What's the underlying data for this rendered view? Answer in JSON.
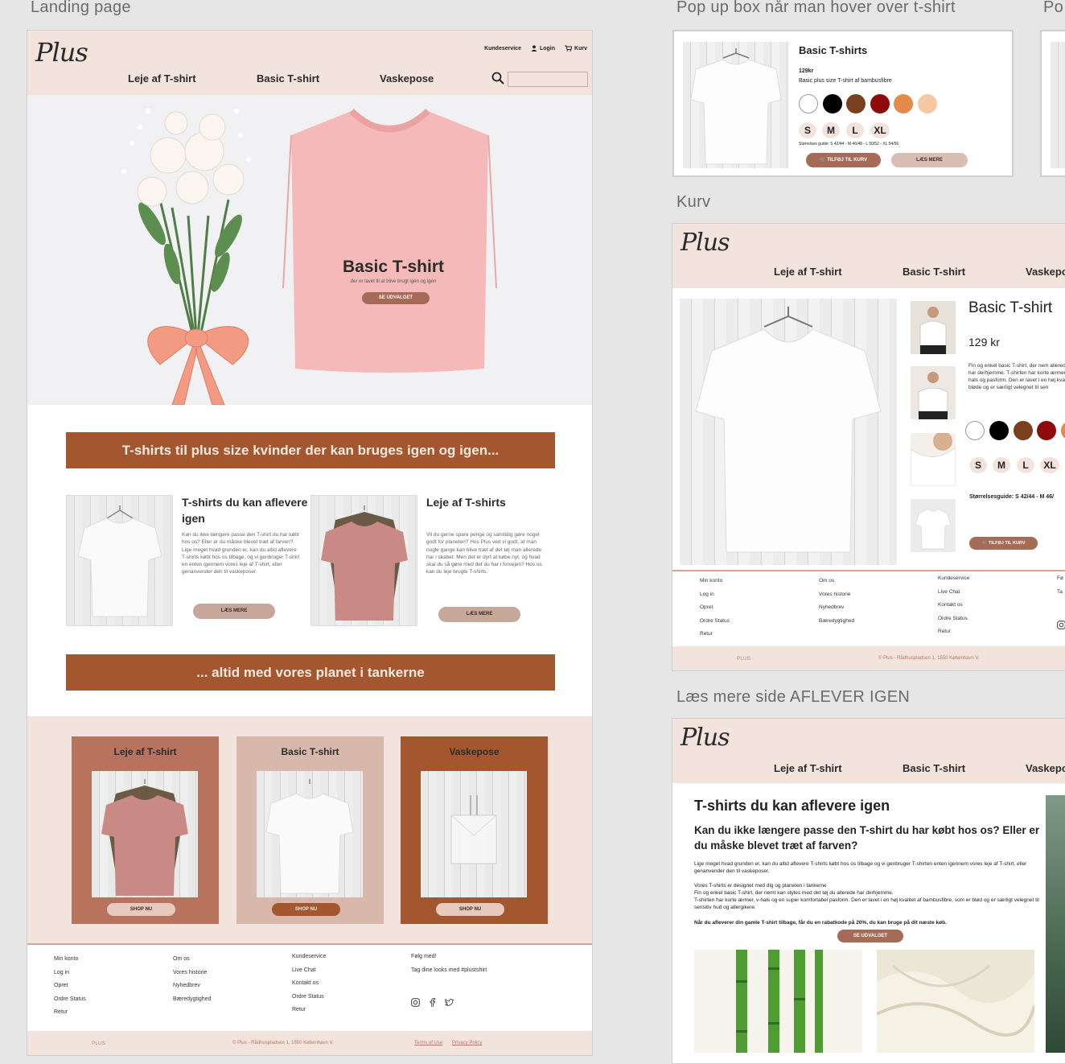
{
  "labels": {
    "landing": "Landing page",
    "popup": "Pop up box når man hover over t-shirt",
    "popup2": "Po",
    "kurv": "Kurv",
    "laes": "Læs mere side AFLEVER IGEN"
  },
  "brand": {
    "logo": "Plus"
  },
  "header": {
    "nav": [
      "Leje af T-shirt",
      "Basic T-shirt",
      "Vaskepose"
    ],
    "nav_cut": "Vaskepo",
    "util": {
      "kundeservice": "Kundeservice",
      "login": "Login",
      "kurv": "Kurv"
    }
  },
  "hero": {
    "title": "Basic T-shirt",
    "subtitle": "der er lavet til at blive brugt igen og igen",
    "button": "SE UDVALGET"
  },
  "banners": {
    "first": "T-shirts til plus size kvinder der kan bruges igen og igen...",
    "second": "... altid med vores planet i tankerne"
  },
  "cards": [
    {
      "title": "T-shirts du kan aflevere igen",
      "text": "Kan du ikke længere passe den T-shirt du har købt hos os? Eller er du måske blevet træt af farven? Lige meget hvad grunden er, kan du altid aflevere T-shirts købt hos os tilbage, og vi genbruger T-shirt en enten igennem vores leje af T-shirt, eller genanvender den til vaskeposer.",
      "button": "LÆS MERE"
    },
    {
      "title": "Leje af T-shirts",
      "text": "Vil du gerne spare penge og samtidig gøre noget godt for planeten? Hos Plus ved vi godt, at man nogle gange kan blive træt af det tøj man allerede har i skabet. Men det er dyrt at købe nyt, og hvad skal du så gøre med det du har i forvejen? Hos os kan du leje brugte T-shirts.",
      "button": "LÆS MERE"
    }
  ],
  "categories": [
    {
      "title": "Leje af T-shirt",
      "button": "SHOP NU"
    },
    {
      "title": "Basic T-shirt",
      "button": "SHOP NU"
    },
    {
      "title": "Vaskepose",
      "button": "SHOP NU"
    }
  ],
  "footer": {
    "col1": [
      "Min konto",
      "Log in",
      "Opret",
      "Ordre Status",
      "Retur"
    ],
    "col2": [
      "Om os",
      "Vores historie",
      "Nyhedbrev",
      "Bæredygtighed"
    ],
    "col3": [
      "Kundeservice",
      "Live Chat",
      "Kontakt os",
      "Ordre Status",
      "Retur"
    ],
    "col4": [
      "Følg med!",
      "Tag dine looks med #plustshirt"
    ],
    "col4_cut": [
      "Fø",
      "Ta"
    ],
    "brand": "PLUS",
    "address": "© Plus - Rådhuspladsen 1, 1550 København V.",
    "terms": "Terms of Use",
    "privacy": "Privacy Policy"
  },
  "popup": {
    "title": "Basic T-shirts",
    "price": "129kr",
    "desc": "Basic plus size T-shirt af bambusfibre",
    "sizes": [
      "S",
      "M",
      "L",
      "XL"
    ],
    "size_guide": "Størrelses guide: S 42/44 - M 46/48 - L 50/52 - XL 54/56",
    "add_button": "TILFØJ TIL KURV",
    "more_button": "LÆS MERE"
  },
  "product": {
    "title": "Basic T-shirt",
    "price": "129 kr",
    "desc": "Fin og enkel basic T-shirt, der nem allerede har derhjemme. T-shirten har korte ærmer, v-hals og pasform. Den er lavet i en høj kvali bløde og er særligt velegnet til sen",
    "sizes": [
      "S",
      "M",
      "L",
      "XL"
    ],
    "size_guide": "Størrelsesguide: S 42/44 - M 46/",
    "button": "TILFØJ TIL KURV"
  },
  "laes": {
    "heading": "T-shirts du kan aflevere igen",
    "subheading": "Kan du ikke længere passe den T-shirt du har købt hos os? Eller er du måske blevet træt af farven?",
    "p1": "Lige meget hvad grunden er, kan du altid aflevere T-shirts købt hos os tilbage og vi genbruger T-shirten enten igennem vores leje af T-shirt, eller genanvender den til vaskeposer.",
    "p2": "Vores T-shirts er designet med dig og planeten i tankerne",
    "p3": "Fin og enkel basic T-shirt, der nemt kan styles med det tøj du allerede har derhjemme.",
    "p4": "T-shirten har korte ærmer, v-hals og en super komfortabel pasform. Den er lavet i en høj kvalitet af bambusfibre, som er blød og er særligt velegnet til sensitiv hud og allergikere.",
    "p5": "Når du afleverer din gamle T-shirt tilbage, får du en rabatkode på 20%, du kan bruge på dit næste køb.",
    "button": "SE UDVALGET"
  },
  "colors": {
    "header_bg": "#f3e3dd",
    "banner": "#a4572f",
    "button_brown": "#a66b56",
    "swatches": [
      "#ffffff",
      "#000000",
      "#7a3f1e",
      "#8f0a0a",
      "#e58a4b",
      "#f6c9a4"
    ]
  }
}
